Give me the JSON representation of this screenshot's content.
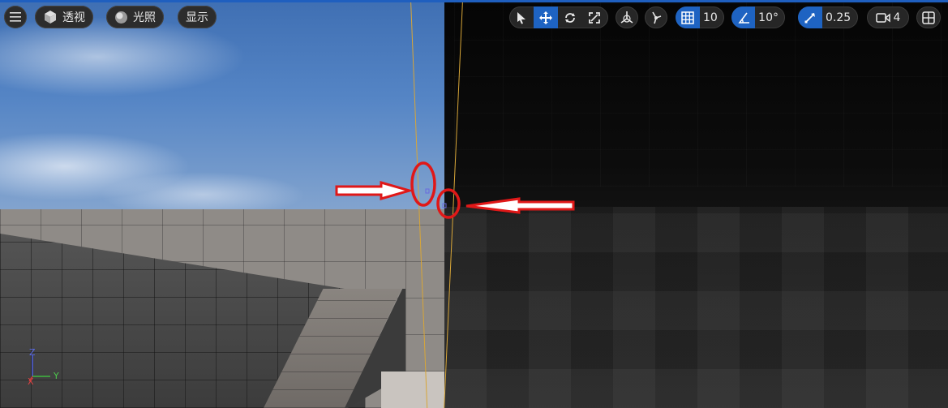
{
  "toolbar_left": {
    "menu_icon": "hamburger-icon",
    "perspective": {
      "label": "透视",
      "icon": "cube-icon"
    },
    "lighting": {
      "label": "光照",
      "icon": "sphere-icon"
    },
    "show": {
      "label": "显示"
    }
  },
  "toolbar_right": {
    "transform_tools": [
      "select-arrow-icon",
      "move-icon",
      "rotate-icon",
      "scale-icon"
    ],
    "active_tool": "move-icon",
    "world_local_icon": "globe-axes-icon",
    "surface_snap_icon": "surface-snap-icon",
    "grid_snap": {
      "icon": "grid-icon",
      "value": "10"
    },
    "rotation_snap": {
      "icon": "angle-icon",
      "value": "10°"
    },
    "scale_snap": {
      "icon": "scale-snap-icon",
      "value": "0.25"
    },
    "camera_speed": {
      "icon": "camera-icon",
      "value": "4"
    },
    "layout_icon": "viewport-layout-icon"
  },
  "axis_gizmo": {
    "z": "Z",
    "y": "Y",
    "x": "X"
  },
  "colors": {
    "accent_blue": "#1e63c2",
    "annotation_red": "#e01818",
    "guide_yellow": "#d8a638",
    "toolbar_bg": "#262626"
  }
}
